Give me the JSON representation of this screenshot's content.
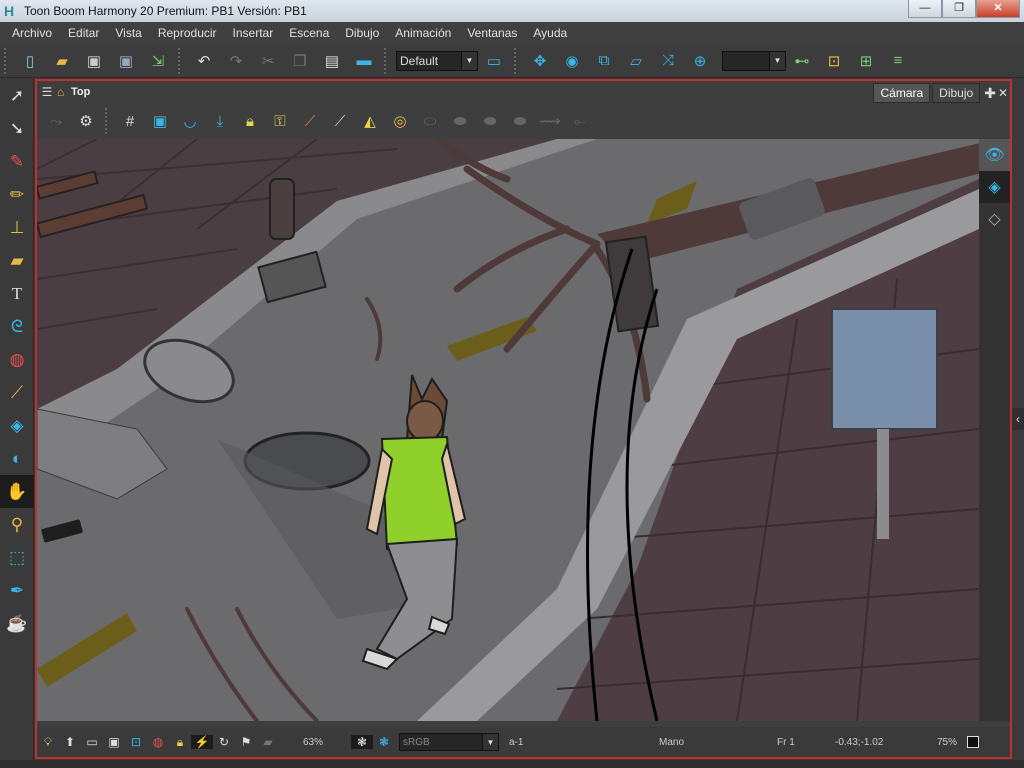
{
  "window": {
    "title": "Toon Boom Harmony 20 Premium: PB1 Versión: PB1",
    "app_icon": "H",
    "min": "—",
    "max": "❐",
    "close": "✕"
  },
  "menu": [
    "Archivo",
    "Editar",
    "Vista",
    "Reproducir",
    "Insertar",
    "Escena",
    "Dibujo",
    "Animación",
    "Ventanas",
    "Ayuda"
  ],
  "toolbar": {
    "workspace_value": "Default",
    "icons": [
      "new-scene-icon",
      "open-icon",
      "save-icon",
      "save-as-icon",
      "export-icon",
      "undo-icon",
      "redo-icon",
      "cut-icon",
      "copy-icon",
      "paste-icon",
      "library-icon",
      "camera-icon",
      "translate-icon",
      "rotate-icon",
      "scale-icon",
      "skew-icon",
      "maintain-size-icon",
      "reset-icon",
      "peg-icon",
      "timing-icon"
    ]
  },
  "left_tools": [
    "select-icon",
    "contour-editor-icon",
    "brush-icon",
    "pencil-icon",
    "stamp-icon",
    "eraser-icon",
    "text-icon",
    "lasso-icon",
    "paint-icon",
    "dropper-icon",
    "pivot-icon",
    "zoom-icon",
    "hand-icon",
    "transform-icon",
    "cutter-icon",
    "pen-icon",
    "camera-shake-icon"
  ],
  "view": {
    "breadcrumb": "Top",
    "tabs": [
      "Cámara",
      "Dibujo"
    ],
    "active_tab": "Cámara"
  },
  "status": {
    "zoom": "63%",
    "color_space": "sRGB",
    "drawing": "a-1",
    "tool": "Mano",
    "frame": "Fr 1",
    "coords": "-0.43;-1.02",
    "percent": "75%"
  },
  "colors": {
    "accent": "#39b6e6",
    "highlight_border": "#c03030",
    "shirt": "#8fd12a",
    "street": "#6b6b6e",
    "sidewalk": "#4a3a3c"
  }
}
